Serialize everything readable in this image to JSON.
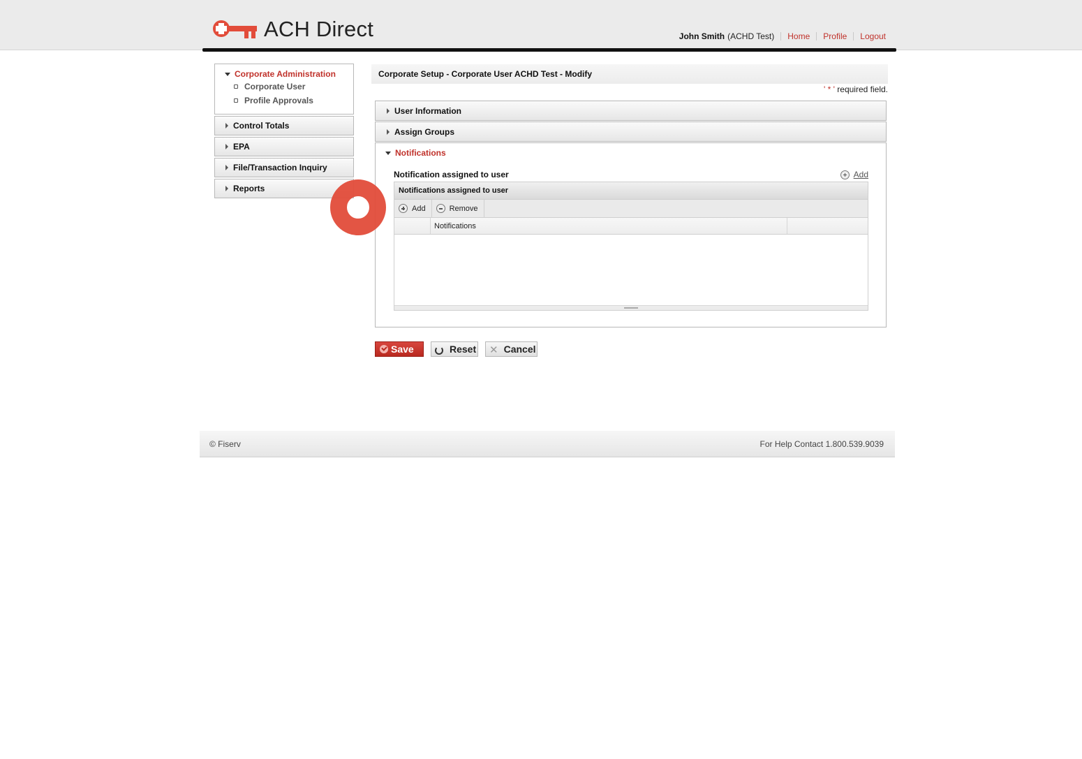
{
  "header": {
    "app_title": "ACH Direct",
    "user_name": "John Smith",
    "user_context": "(ACHD Test)",
    "nav": [
      "Home",
      "Profile",
      "Logout"
    ]
  },
  "sidebar": {
    "open_section": "Corporate Administration",
    "sub_items": [
      "Corporate User",
      "Profile Approvals"
    ],
    "sections": [
      "Control Totals",
      "EPA",
      "File/Transaction Inquiry",
      "Reports"
    ]
  },
  "main": {
    "page_title": "Corporate Setup - Corporate User ACHD Test - Modify",
    "required_star": "' * '",
    "required_text": "required field.",
    "accordions": [
      "User Information",
      "Assign Groups"
    ],
    "notifications": {
      "header": "Notifications",
      "label": "Notification assigned to user",
      "add_link": "Add",
      "grid": {
        "caption": "Notifications assigned to user",
        "add_label": "Add",
        "remove_label": "Remove",
        "column_header": "Notifications",
        "rows": []
      }
    }
  },
  "actions": {
    "save": "Save",
    "reset": "Reset",
    "cancel": "Cancel"
  },
  "footer": {
    "copyright": "© Fiserv",
    "help": "For Help Contact 1.800.539.9039"
  },
  "colors": {
    "accent": "#c0322b",
    "marker": "#e24c3a"
  }
}
